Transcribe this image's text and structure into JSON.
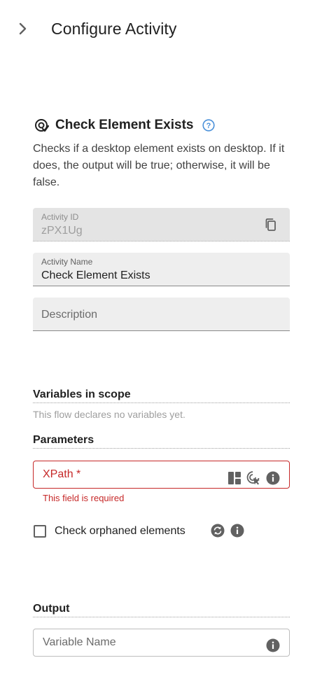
{
  "header": {
    "title": "Configure Activity"
  },
  "activity": {
    "title": "Check Element Exists",
    "description": "Checks if a desktop element exists on desktop. If it does, the output will be true; otherwise, it will be false."
  },
  "fields": {
    "activity_id_label": "Activity ID",
    "activity_id_value": "zPX1Ug",
    "activity_name_label": "Activity Name",
    "activity_name_value": "Check Element Exists",
    "description_placeholder": "Description"
  },
  "variables": {
    "title": "Variables in scope",
    "empty_note": "This flow declares no variables yet."
  },
  "parameters": {
    "title": "Parameters",
    "xpath_label": "XPath *",
    "xpath_error": "This field is required",
    "check_orphaned_label": "Check orphaned elements",
    "check_orphaned_checked": false
  },
  "output": {
    "title": "Output",
    "variable_placeholder": "Variable Name"
  },
  "colors": {
    "error": "#c62828",
    "help_blue": "#4a90d9",
    "icon_gray": "#616161",
    "field_bg": "#eeeeee"
  }
}
